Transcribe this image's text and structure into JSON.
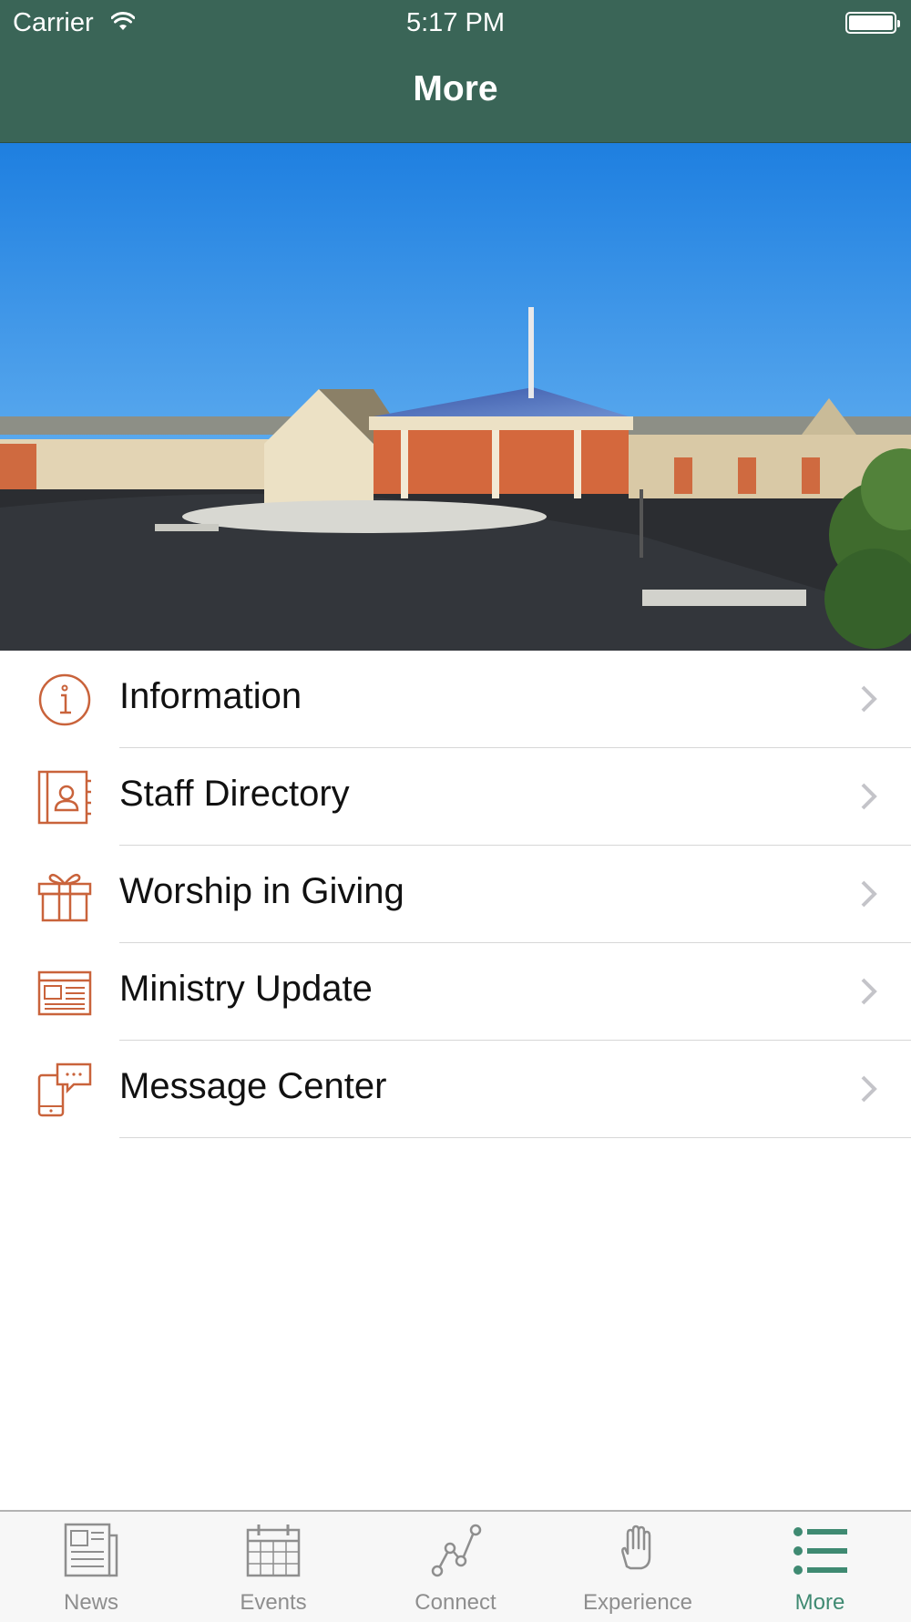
{
  "status_bar": {
    "carrier": "Carrier",
    "time": "5:17 PM"
  },
  "nav": {
    "title": "More"
  },
  "hero": {
    "image": "church-building-photo"
  },
  "menu": [
    {
      "label": "Information",
      "icon": "info-icon"
    },
    {
      "label": "Staff Directory",
      "icon": "directory-icon"
    },
    {
      "label": "Worship in Giving",
      "icon": "gift-icon"
    },
    {
      "label": "Ministry Update",
      "icon": "newsletter-icon"
    },
    {
      "label": "Message Center",
      "icon": "message-phone-icon"
    }
  ],
  "tabs": [
    {
      "label": "News",
      "icon": "newspaper-icon",
      "active": false
    },
    {
      "label": "Events",
      "icon": "calendar-icon",
      "active": false
    },
    {
      "label": "Connect",
      "icon": "connect-icon",
      "active": false
    },
    {
      "label": "Experience",
      "icon": "hand-icon",
      "active": false
    },
    {
      "label": "More",
      "icon": "list-icon",
      "active": true
    }
  ],
  "colors": {
    "nav_bar": "#3a6557",
    "icon_accent": "#c9633b",
    "active_tab": "#3f8a72",
    "inactive_tab": "#8e8e8e"
  }
}
